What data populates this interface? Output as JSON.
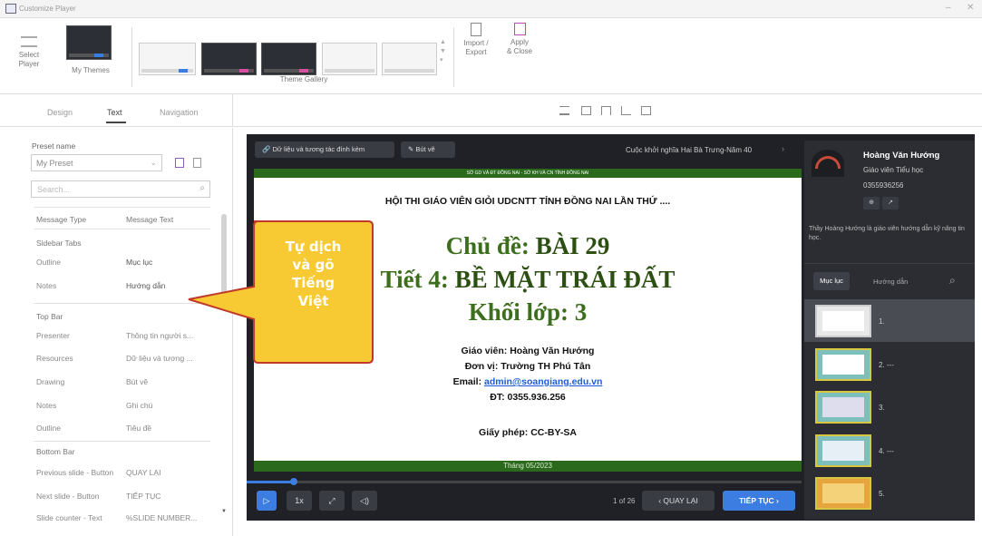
{
  "window": {
    "title": "Customize Player",
    "minimize": "–",
    "close": "✕"
  },
  "ribbon": {
    "select_player": "Select\nPlayer",
    "my_themes": "My Themes",
    "theme_gallery": "Theme Gallery",
    "import_export": "Import /\nExport",
    "apply_close": "Apply\n& Close"
  },
  "tabs": [
    "Design",
    "Text",
    "Navigation"
  ],
  "preset": {
    "label": "Preset name",
    "value": "My Preset",
    "search_placeholder": "Search..."
  },
  "table": {
    "col1": "Message Type",
    "col2": "Message Text",
    "sidebar_tabs": {
      "title": "Sidebar Tabs",
      "rows": [
        [
          "Outline",
          "Mục lục"
        ],
        [
          "Notes",
          "Hướng dẫn"
        ]
      ]
    },
    "top_bar": {
      "title": "Top Bar",
      "rows": [
        [
          "Presenter",
          "Thông tin người s..."
        ],
        [
          "Resources",
          "Dữ liệu và tương ..."
        ],
        [
          "Drawing",
          "Bút vẽ"
        ],
        [
          "Notes",
          "Ghi chú"
        ],
        [
          "Outline",
          "Tiêu đề"
        ]
      ]
    },
    "bottom_bar": {
      "title": "Bottom Bar",
      "rows": [
        [
          "Previous slide - Button",
          "QUAY LẠI"
        ],
        [
          "Next slide - Button",
          "TIẾP TỤC"
        ],
        [
          "Slide counter - Text",
          "%SLIDE NUMBER..."
        ]
      ]
    }
  },
  "callout": "Tự dịch\nvà gõ\nTiếng\nViệt",
  "player": {
    "top_resources": "Dữ liệu và tương tác đính kèm",
    "top_drawing": "Bút vẽ",
    "top_title": "Cuộc khởi nghĩa Hai Bà Trưng-Năm 40",
    "speed": "1x",
    "counter": "1 of 26",
    "prev": "‹  QUAY LẠI",
    "next": "TIẾP TỤC  ›"
  },
  "slide": {
    "header": "SỞ GD VÀ ĐT ĐỒNG NAI - SỞ KH VÀ CN TỈNH ĐỒNG NAI",
    "contest": "HỘI THI GIÁO VIÊN GIỎI UDCNTT TỈNH ĐỒNG NAI LẦN THỨ ....",
    "line1_a": "Chủ đề: ",
    "line1_b": "BÀI 29",
    "line2_a": "Tiết 4: ",
    "line2_b": "BỀ MẶT TRÁI ĐẤT",
    "line3": "Khối lớp: 3",
    "teacher": "Giáo viên: Hoàng Văn Hướng",
    "unit": "Đơn vị: Trường TH Phú Tân",
    "email_label": "Email: ",
    "email": "admin@soangiang.edu.vn",
    "phone": "ĐT: 0355.936.256",
    "license": "Giấy phép: CC-BY-SA",
    "date": "Tháng 05/2023"
  },
  "presenter": {
    "name": "Hoàng Văn Hướng",
    "role": "Giáo viên Tiểu học",
    "phone": "0355936256",
    "bio": "Thầy Hoàng Hướng là giáo viên hướng dẫn kỹ năng tin học."
  },
  "sidebar_tabs": {
    "outline": "Mục lục",
    "notes": "Hướng dẫn"
  },
  "menu_items": [
    "1.",
    "2. ---",
    "3.",
    "4. ---",
    "5."
  ],
  "colors": {
    "accent_blue": "#3b7de0",
    "slide_green": "#3c6e1e",
    "callout_yellow": "#f7c932",
    "callout_border": "#c0392b"
  }
}
